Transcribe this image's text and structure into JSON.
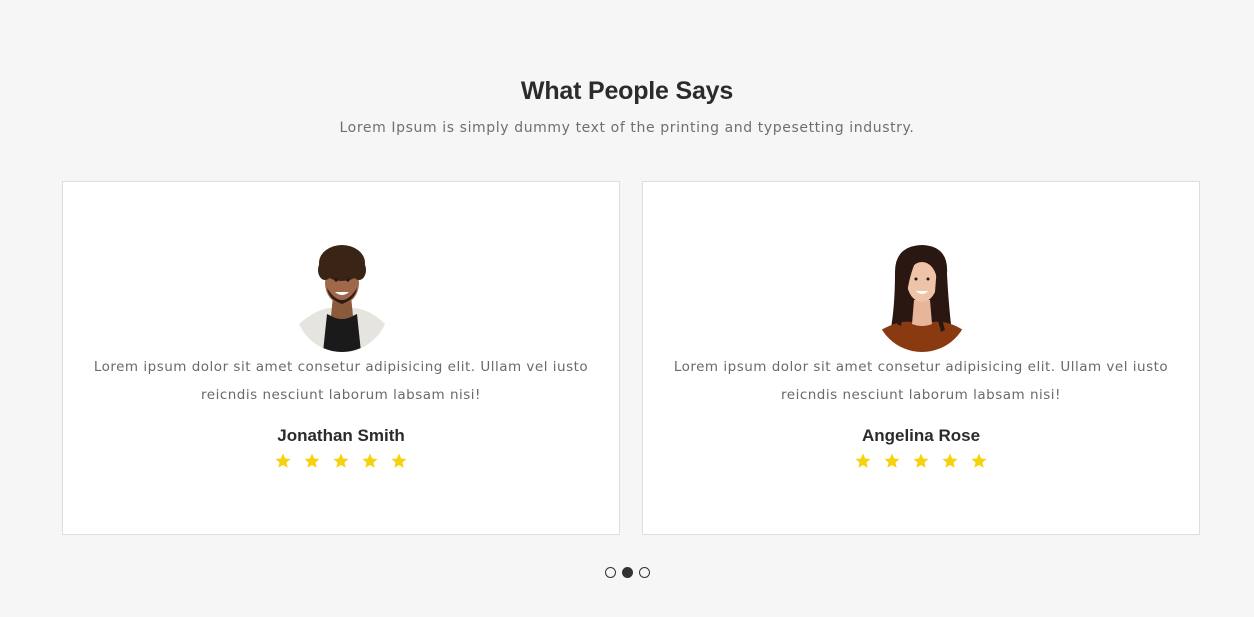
{
  "section": {
    "title": "What People Says",
    "subtitle": "Lorem Ipsum is simply dummy text of the printing and typesetting industry."
  },
  "testimonials": [
    {
      "quote": "Lorem ipsum dolor sit amet consetur adipisicing elit. Ullam vel iusto reicndis nesciunt laborum labsam nisi!",
      "name": "Jonathan Smith",
      "rating": 5,
      "avatar": "man-portrait"
    },
    {
      "quote": "Lorem ipsum dolor sit amet consetur adipisicing elit. Ullam vel iusto reicndis nesciunt laborum labsam nisi!",
      "name": "Angelina Rose",
      "rating": 5,
      "avatar": "woman-portrait"
    }
  ],
  "carousel": {
    "page_count": 3,
    "active_page": 2
  },
  "colors": {
    "background": "#f6f6f6",
    "card": "#ffffff",
    "star": "#f5d20b",
    "heading": "#2b2b2b"
  }
}
